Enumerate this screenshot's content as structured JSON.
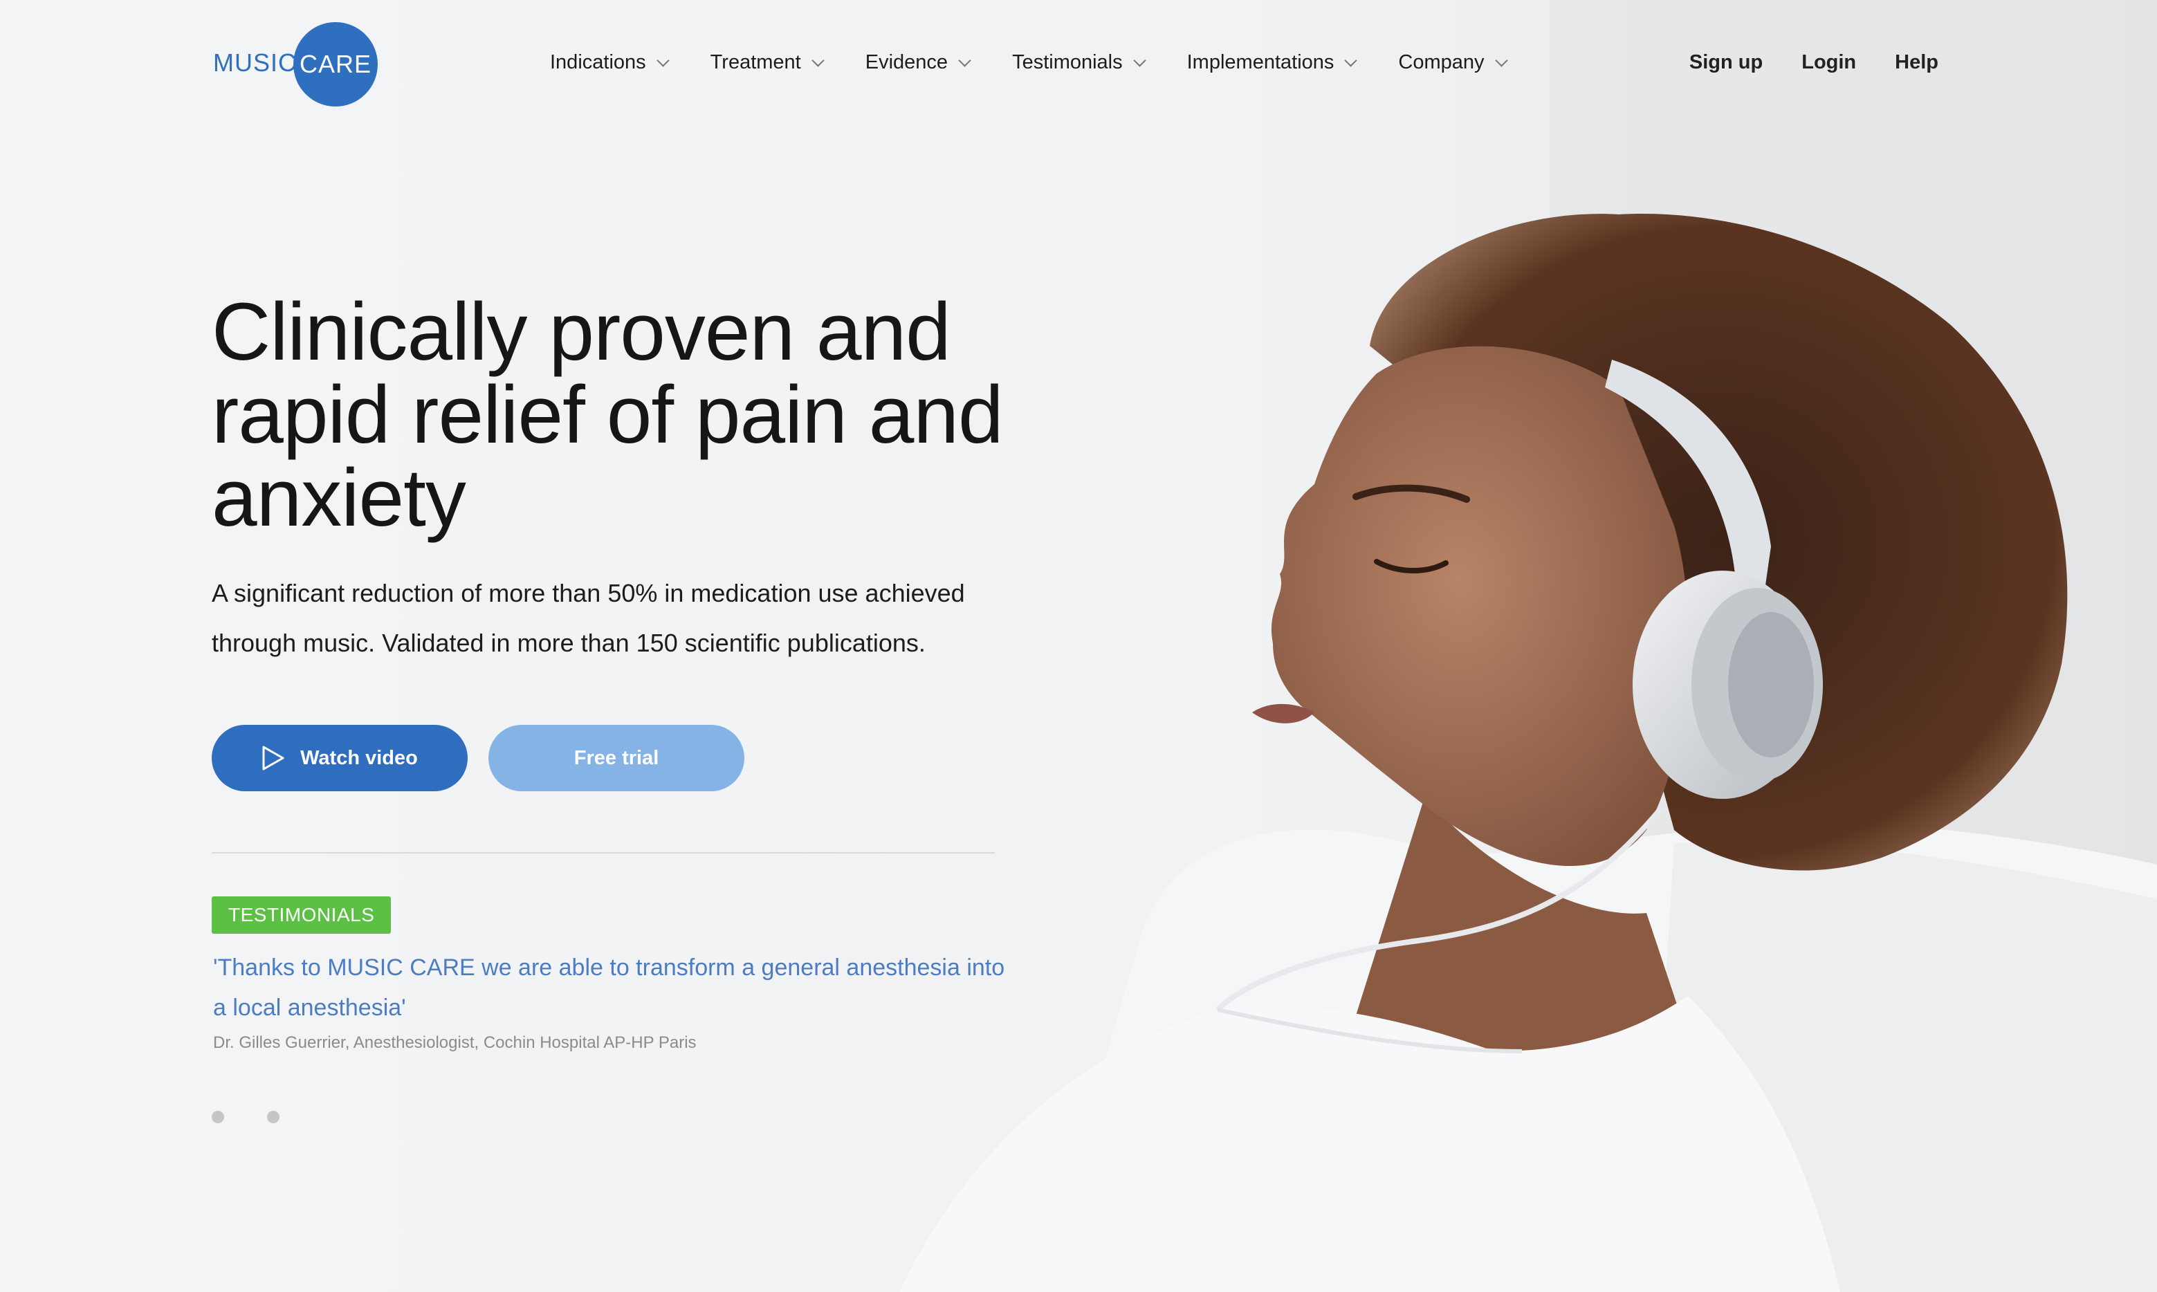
{
  "logo": {
    "word1": "MUSIC",
    "word2": "CARE"
  },
  "nav": {
    "items": [
      {
        "label": "Indications"
      },
      {
        "label": "Treatment"
      },
      {
        "label": "Evidence"
      },
      {
        "label": "Testimonials"
      },
      {
        "label": "Implementations"
      },
      {
        "label": "Company"
      }
    ]
  },
  "account": {
    "signup": "Sign up",
    "login": "Login",
    "help": "Help"
  },
  "hero": {
    "headline": "Clinically proven and rapid relief of pain and anxiety",
    "subhead": "A significant reduction of more than 50% in medication use achieved through music. Validated in more than 150 scientific publications.",
    "watch_label": "Watch video",
    "trial_label": "Free trial"
  },
  "testimonial": {
    "tag": "TESTIMONIALS",
    "quote": "'Thanks to MUSIC CARE we are able to transform a general anesthesia into a local anesthesia'",
    "author": "Dr. Gilles Guerrier, Anesthesiologist, Cochin Hospital AP-HP Paris",
    "active_slide": 1,
    "slide_count": 2
  },
  "colors": {
    "brand_blue": "#2f6fc0",
    "light_blue": "#86b3e6",
    "tag_green": "#5cc044",
    "quote_blue": "#4c7cc2"
  }
}
